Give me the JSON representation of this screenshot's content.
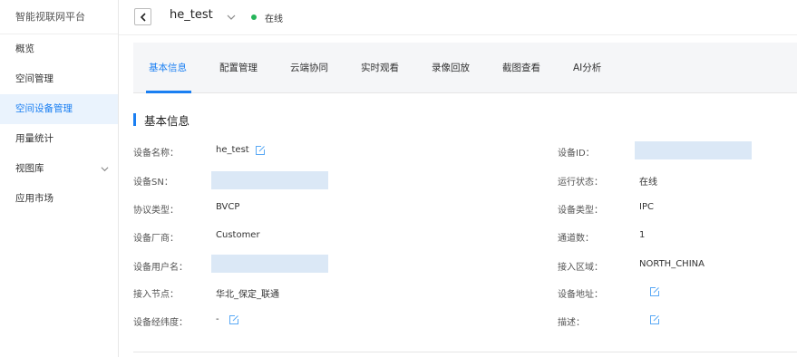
{
  "app": {
    "title": "智能视联网平台"
  },
  "sidebar": {
    "items": [
      {
        "label": "概览"
      },
      {
        "label": "空间管理"
      },
      {
        "label": "空间设备管理"
      },
      {
        "label": "用量统计"
      },
      {
        "label": "视图库"
      },
      {
        "label": "应用市场"
      }
    ],
    "active_index": 2
  },
  "header": {
    "device_name": "he_test",
    "status_text": "在线",
    "status_color": "#26b55a"
  },
  "tabs": [
    {
      "label": "基本信息"
    },
    {
      "label": "配置管理"
    },
    {
      "label": "云端协同"
    },
    {
      "label": "实时观看"
    },
    {
      "label": "录像回放"
    },
    {
      "label": "截图查看"
    },
    {
      "label": "AI分析"
    }
  ],
  "section": {
    "title": "基本信息"
  },
  "fields": {
    "device_name": {
      "label": "设备名称：",
      "value": "he_test"
    },
    "device_sn": {
      "label": "设备SN：",
      "value": ""
    },
    "protocol": {
      "label": "协议类型：",
      "value": "BVCP"
    },
    "vendor": {
      "label": "设备厂商：",
      "value": "Customer"
    },
    "username": {
      "label": "设备用户名：",
      "value": ""
    },
    "access_node": {
      "label": "接入节点：",
      "value": "华北_保定_联通"
    },
    "coords": {
      "label": "设备经纬度：",
      "value": "-"
    },
    "device_id": {
      "label": "设备ID：",
      "value": ""
    },
    "run_status": {
      "label": "运行状态：",
      "value": "在线"
    },
    "device_type": {
      "label": "设备类型：",
      "value": "IPC"
    },
    "channels": {
      "label": "通道数：",
      "value": "1"
    },
    "region": {
      "label": "接入区域：",
      "value": "NORTH_CHINA"
    },
    "address": {
      "label": "设备地址：",
      "value": ""
    },
    "description": {
      "label": "描述：",
      "value": ""
    }
  },
  "colors": {
    "accent": "#1a7ff2",
    "redacted": "#dbe8f6"
  }
}
